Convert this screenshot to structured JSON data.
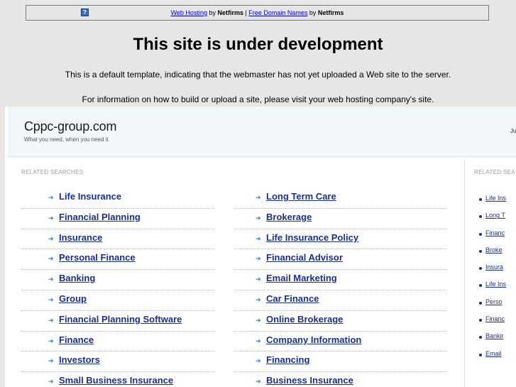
{
  "topbar": {
    "link1": "Web Hosting",
    "by1": " by ",
    "brand1": "Netfirms",
    "sep": " | ",
    "link2": "Free Domain Names",
    "by2": " by ",
    "brand2": "Netfirms",
    "icon": "question-icon"
  },
  "dev": {
    "title": "This site is under development",
    "info1": "This is a default template, indicating that the webmaster has not yet uploaded a Web site to the server.",
    "info2": "For information on how to build or upload a site, please visit your web hosting company's site."
  },
  "site": {
    "title": "Cppc-group.com",
    "tagline": "What you need, when you need it",
    "header_right": "Ju"
  },
  "main": {
    "section_label": "RELATED SEARCHES",
    "left": [
      {
        "label": "Life Insurance"
      },
      {
        "label": "Financial Planning"
      },
      {
        "label": "Insurance"
      },
      {
        "label": "Personal Finance"
      },
      {
        "label": "Banking"
      },
      {
        "label": "Group"
      },
      {
        "label": "Financial Planning Software"
      },
      {
        "label": "Finance"
      },
      {
        "label": "Investors"
      },
      {
        "label": "Small Business Insurance"
      }
    ],
    "right": [
      {
        "label": "Long Term Care"
      },
      {
        "label": "Brokerage"
      },
      {
        "label": "Life Insurance Policy"
      },
      {
        "label": "Financial Advisor"
      },
      {
        "label": "Email Marketing"
      },
      {
        "label": "Car Finance"
      },
      {
        "label": "Online Brokerage"
      },
      {
        "label": "Company Information"
      },
      {
        "label": "Financing"
      },
      {
        "label": "Business Insurance"
      }
    ]
  },
  "side": {
    "section_label": "RELATED SEA",
    "items": [
      {
        "label": "Life Ins"
      },
      {
        "label": "Long T"
      },
      {
        "label": "Financ"
      },
      {
        "label": "Broke"
      },
      {
        "label": "Insura"
      },
      {
        "label": "Life Ins"
      },
      {
        "label": "Perso"
      },
      {
        "label": "Financ"
      },
      {
        "label": "Bankir"
      },
      {
        "label": "Email"
      }
    ]
  },
  "colors": {
    "link": "#1a2f8a",
    "arrow": "#2a7fb8",
    "page_bg": "#e6e6e6",
    "header_bg": "#f2f7fa"
  }
}
